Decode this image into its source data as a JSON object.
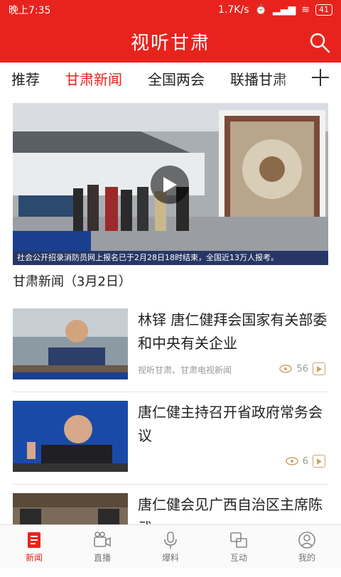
{
  "status": {
    "time": "晚上7:35",
    "speed": "1.7K/s",
    "battery": "41"
  },
  "app": {
    "title": "视听甘肃"
  },
  "tabs": [
    {
      "label": "推荐"
    },
    {
      "label": "甘肃新闻"
    },
    {
      "label": "全国两会"
    },
    {
      "label": "联播甘肃"
    }
  ],
  "hero": {
    "ticker": "社会公开招录消防员网上报名已于2月28日18时结束，全国近13万人报考。",
    "caption": "甘肃新闻（3月2日）"
  },
  "articles": [
    {
      "title": "林铎 唐仁健拜会国家有关部委和中央有关企业",
      "source": "视听甘肃、甘肃电视新闻",
      "views": "56"
    },
    {
      "title": "唐仁健主持召开省政府常务会议",
      "source": "",
      "views": "6"
    },
    {
      "title": "唐仁健会见广西自治区主席陈武",
      "source": "",
      "views": ""
    }
  ],
  "nav": [
    {
      "label": "新闻",
      "icon": "news-icon"
    },
    {
      "label": "直播",
      "icon": "live-camera-icon"
    },
    {
      "label": "爆料",
      "icon": "microphone-icon"
    },
    {
      "label": "互动",
      "icon": "interact-icon"
    },
    {
      "label": "我的",
      "icon": "profile-icon"
    }
  ],
  "colors": {
    "brand": "#e8231d"
  }
}
